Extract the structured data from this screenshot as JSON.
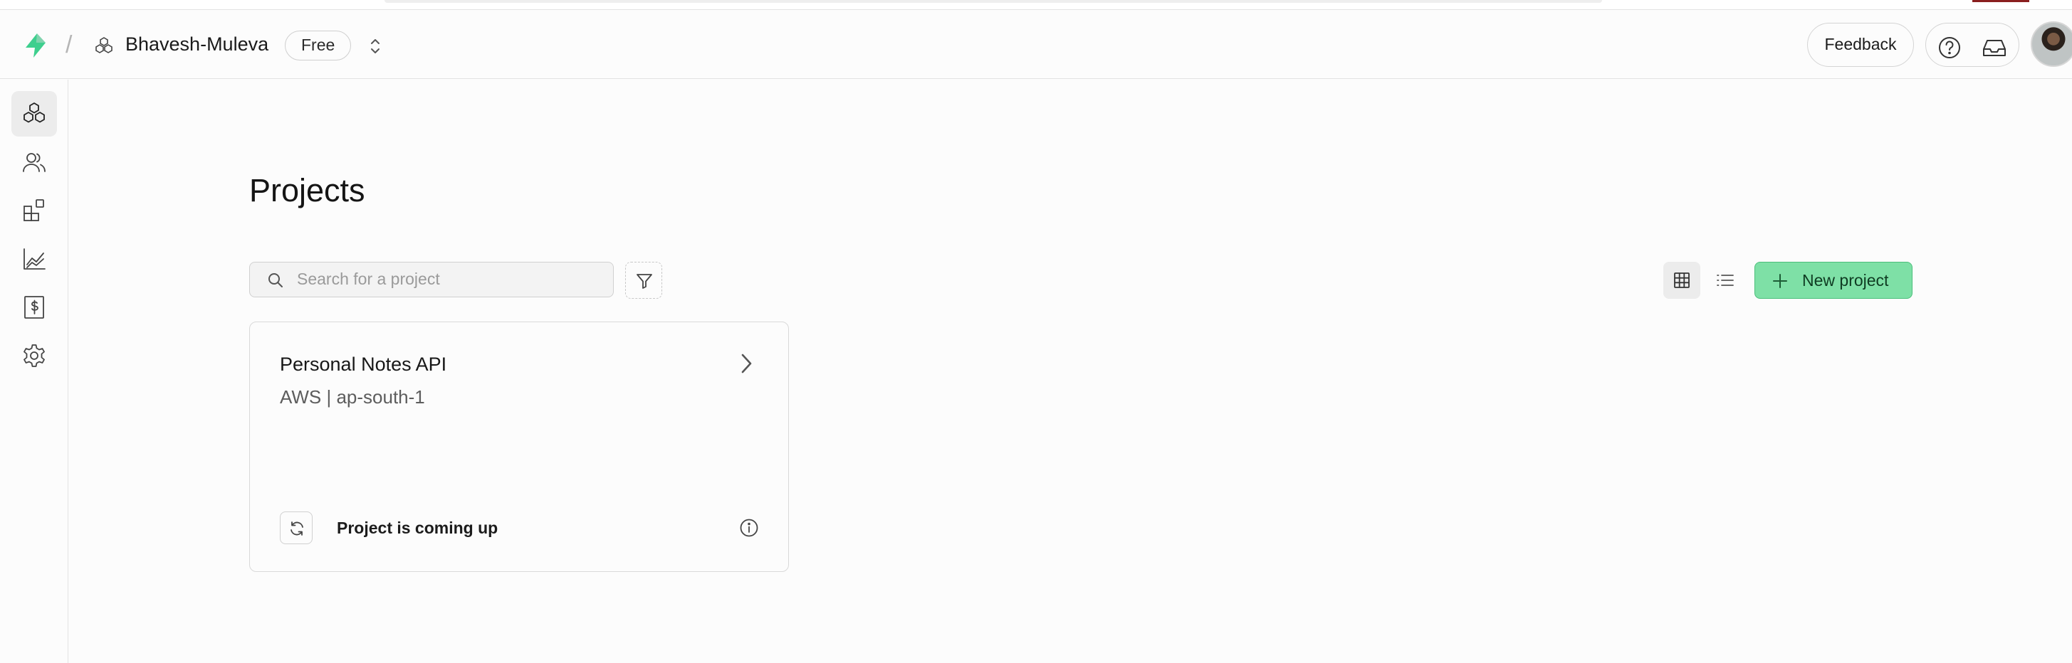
{
  "header": {
    "separator": "/",
    "org_name": "Bhavesh-Muleva",
    "plan_badge": "Free",
    "feedback_label": "Feedback"
  },
  "icons": {
    "logo": "lightning-bolt-logo",
    "org": "org-cubes-icon",
    "switch": "chevron-up-down-icon",
    "help": "help-circle-icon",
    "inbox": "inbox-icon",
    "sidebar": [
      "projects-cubes-icon",
      "team-users-icon",
      "integrations-blocks-icon",
      "usage-chart-icon",
      "billing-receipt-icon",
      "settings-gear-icon"
    ]
  },
  "main": {
    "title": "Projects",
    "search_placeholder": "Search for a project",
    "new_project_label": "New project"
  },
  "projects": [
    {
      "name": "Personal Notes API",
      "region": "AWS | ap-south-1",
      "status": "Project is coming up"
    }
  ],
  "colors": {
    "brand_green": "#3ecf8e",
    "new_project_bg": "#7ee0a6",
    "new_project_border": "#4cbf7b"
  }
}
